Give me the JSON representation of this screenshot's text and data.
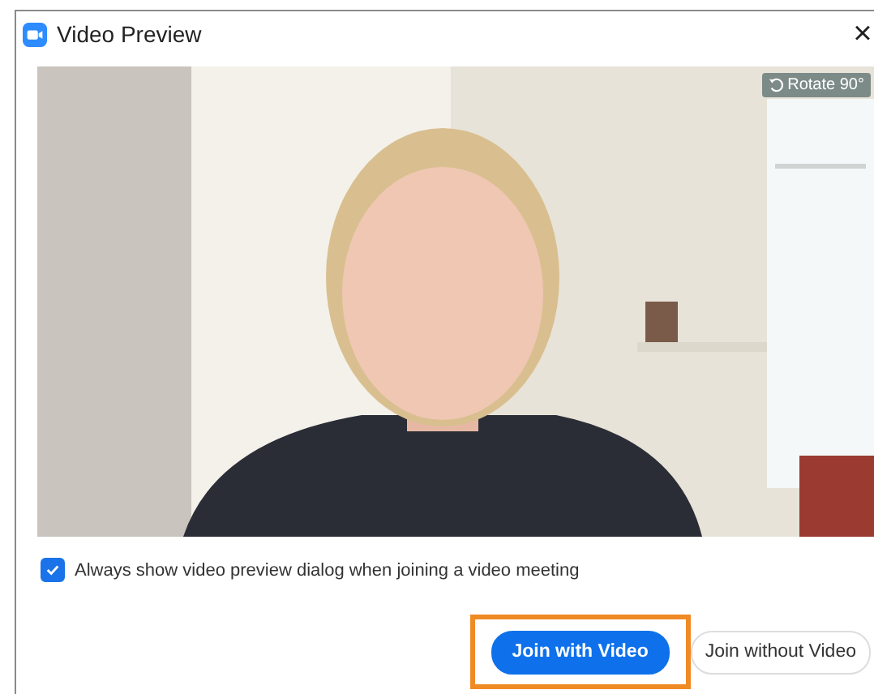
{
  "window": {
    "title": "Video Preview",
    "close": "×"
  },
  "preview": {
    "kind": "picture",
    "rotate": "Rotate 90°"
  },
  "always_show": {
    "label": "Always show video preview dialog when joining a video meeting",
    "checked": true
  },
  "buttons": [
    {
      "label": "Join with Video",
      "kind": "primary",
      "highlighted": true
    },
    {
      "label": "Join without Video",
      "kind": "secondary",
      "highlighted": false
    }
  ]
}
